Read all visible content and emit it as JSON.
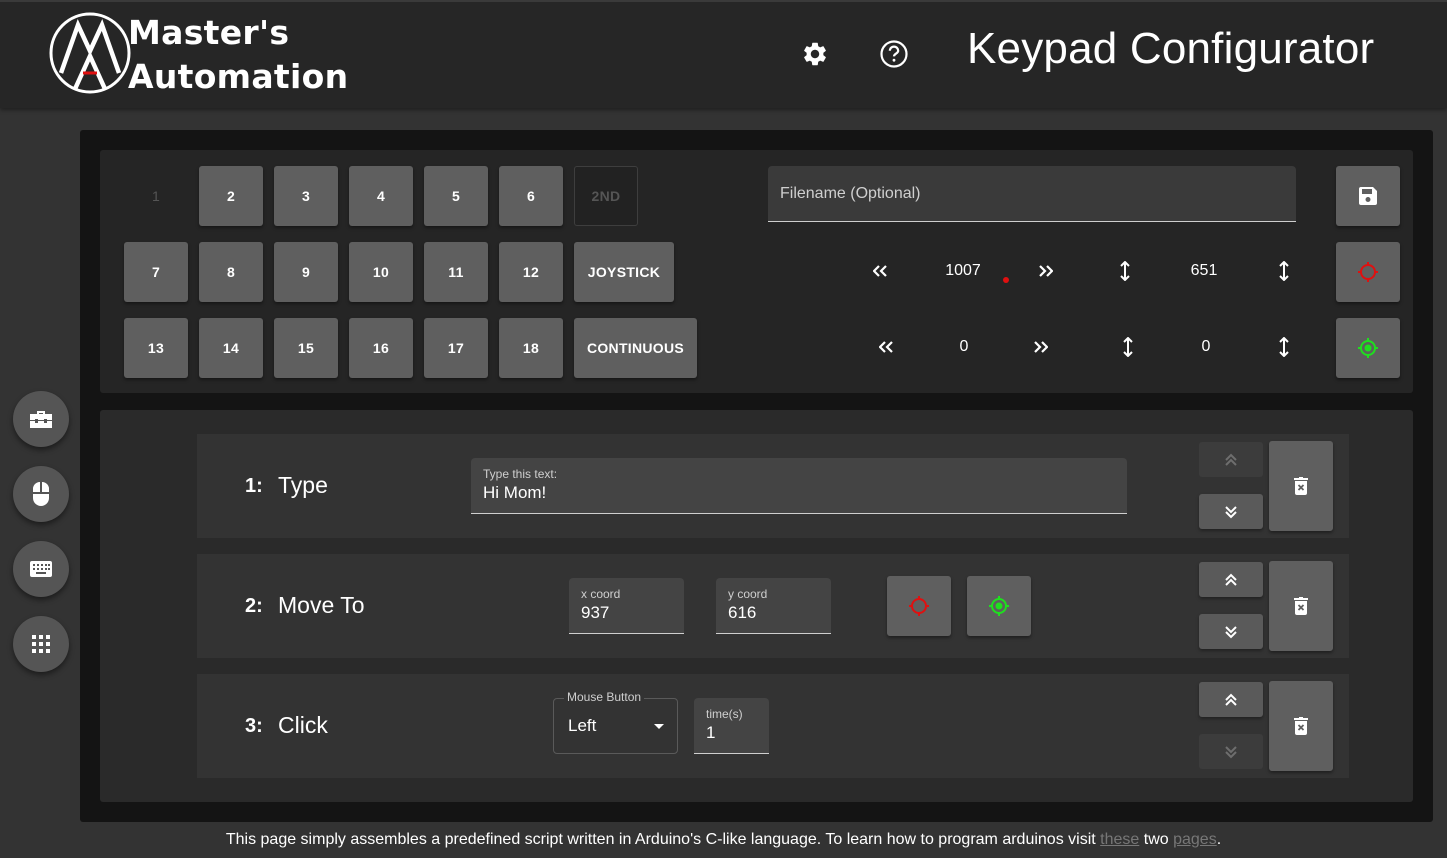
{
  "header": {
    "logo_line1": "Master's",
    "logo_line2": "Automation",
    "title": "Keypad Configurator",
    "settings_icon": "gear-icon",
    "help_icon": "help-circle-icon"
  },
  "sidebar": {
    "buttons": [
      {
        "name": "toolbox",
        "icon": "toolbox-icon"
      },
      {
        "name": "mouse",
        "icon": "mouse-icon"
      },
      {
        "name": "keyboard",
        "icon": "keyboard-icon"
      },
      {
        "name": "keypad",
        "icon": "grid-icon"
      }
    ]
  },
  "keypad": {
    "row1": [
      "1",
      "2",
      "3",
      "4",
      "5",
      "6",
      "2ND"
    ],
    "row2": [
      "7",
      "8",
      "9",
      "10",
      "11",
      "12",
      "JOYSTICK"
    ],
    "row3": [
      "13",
      "14",
      "15",
      "16",
      "17",
      "18",
      "CONTINUOUS"
    ],
    "selected_key": "1"
  },
  "filename": {
    "placeholder": "Filename (Optional)",
    "value": ""
  },
  "position": {
    "current": {
      "x": "1007",
      "y": "651"
    },
    "offset": {
      "x": "0",
      "y": "0"
    },
    "left_glyph": "«",
    "right_glyph": "»",
    "vert_glyph": "↕"
  },
  "colors": {
    "red_target": "#e01010",
    "green_target": "#1ee01e"
  },
  "steps": [
    {
      "num": "1:",
      "name": "Type",
      "field_label": "Type this text:",
      "field_value": "Hi Mom!",
      "up_disabled": true,
      "down_disabled": false
    },
    {
      "num": "2:",
      "name": "Move To",
      "x_label": "x coord",
      "x_value": "937",
      "y_label": "y coord",
      "y_value": "616",
      "up_disabled": false,
      "down_disabled": false
    },
    {
      "num": "3:",
      "name": "Click",
      "select_label": "Mouse Button",
      "select_value": "Left",
      "times_label": "time(s)",
      "times_value": "1",
      "up_disabled": false,
      "down_disabled": true
    }
  ],
  "footer": {
    "text": "This page simply assembles a predefined script written in Arduino's C-like language. To learn how to program arduinos visit ",
    "link1": "these",
    "middle": " two ",
    "link2": "pages",
    "end": "."
  }
}
